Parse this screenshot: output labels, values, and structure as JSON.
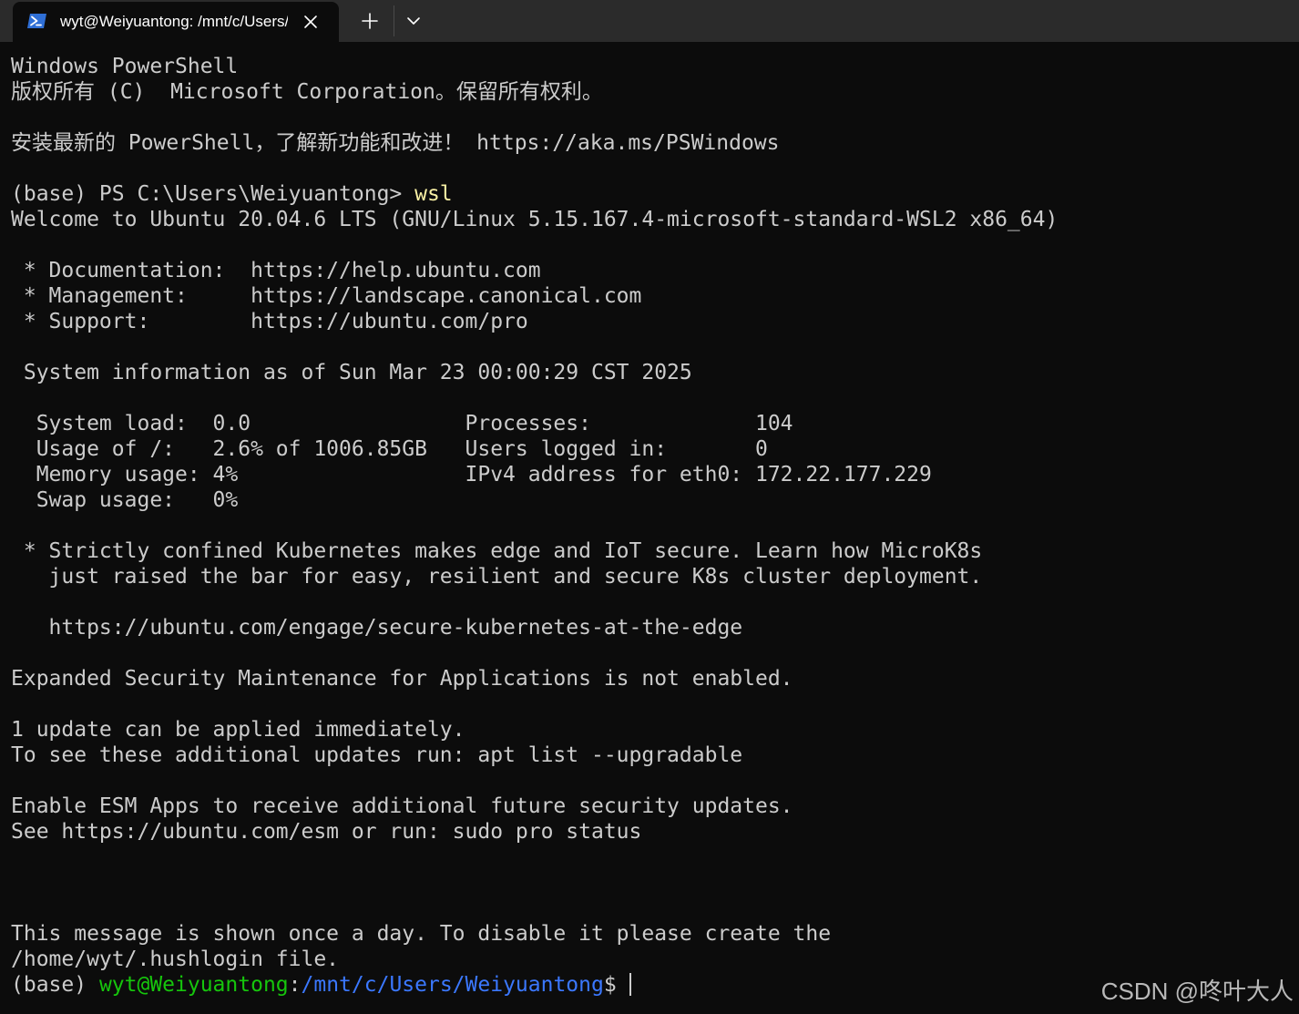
{
  "tab": {
    "title": "wyt@Weiyuantong: /mnt/c/Users/Weiyuantong",
    "icon": "powershell-icon",
    "close_icon": "close-icon"
  },
  "tabbar": {
    "new_tab_icon": "plus-icon",
    "dropdown_icon": "chevron-down-icon"
  },
  "colors": {
    "background": "#0c0c0c",
    "text": "#cccccc",
    "command": "#f9f1a5",
    "prompt_user": "#16c60c",
    "prompt_path": "#3b78ff",
    "tab_active": "#0c0c0c",
    "tabbar": "#2b2b2b"
  },
  "terminal": {
    "lines": [
      "Windows PowerShell",
      "版权所有 (C)  Microsoft Corporation。保留所有权利。",
      "",
      "安装最新的 PowerShell，了解新功能和改进！ https://aka.ms/PSWindows",
      "",
      "",
      "Welcome to Ubuntu 20.04.6 LTS (GNU/Linux 5.15.167.4-microsoft-standard-WSL2 x86_64)",
      "",
      " * Documentation:  https://help.ubuntu.com",
      " * Management:     https://landscape.canonical.com",
      " * Support:        https://ubuntu.com/pro",
      "",
      " System information as of Sun Mar 23 00:00:29 CST 2025",
      "",
      "  System load:  0.0                 Processes:             104",
      "  Usage of /:   2.6% of 1006.85GB   Users logged in:       0",
      "  Memory usage: 4%                  IPv4 address for eth0: 172.22.177.229",
      "  Swap usage:   0%",
      "",
      " * Strictly confined Kubernetes makes edge and IoT secure. Learn how MicroK8s",
      "   just raised the bar for easy, resilient and secure K8s cluster deployment.",
      "",
      "   https://ubuntu.com/engage/secure-kubernetes-at-the-edge",
      "",
      "Expanded Security Maintenance for Applications is not enabled.",
      "",
      "1 update can be applied immediately.",
      "To see these additional updates run: apt list --upgradable",
      "",
      "Enable ESM Apps to receive additional future security updates.",
      "See https://ubuntu.com/esm or run: sudo pro status",
      "",
      "",
      "",
      "This message is shown once a day. To disable it please create the",
      "/home/wyt/.hushlogin file."
    ],
    "ps_prompt": "(base) PS C:\\Users\\Weiyuantong> ",
    "ps_command": "wsl",
    "bash_prompt": {
      "env": "(base) ",
      "user_host": "wyt@Weiyuantong",
      "colon": ":",
      "path": "/mnt/c/Users/Weiyuantong",
      "symbol": "$"
    }
  },
  "watermark": "CSDN @咚叶大人"
}
